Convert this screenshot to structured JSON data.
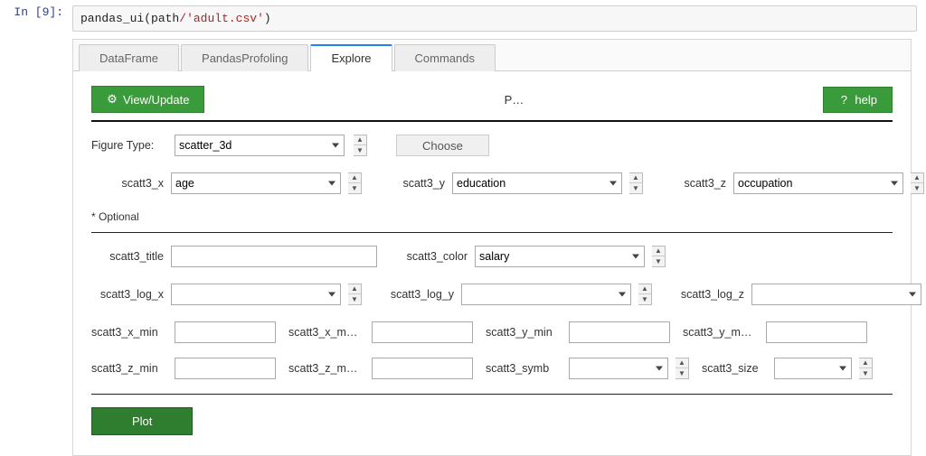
{
  "prompt": "In [9]:",
  "code": {
    "fn": "pandas_ui",
    "path_var": "path",
    "op": "/",
    "arg": "'adult.csv'"
  },
  "tabs": {
    "dataframe": "DataFrame",
    "profiling": "PandasProfoling",
    "explore": "Explore",
    "commands": "Commands",
    "active": "explore"
  },
  "panel": {
    "viewupdate": "View/Update",
    "viewupdate_icon": "⚙",
    "midchar": "P…",
    "help": "help",
    "help_icon": "?",
    "figure_type_label": "Figure Type:",
    "figure_type_value": "scatter_3d",
    "choose_label": "Choose",
    "optional": "* Optional",
    "plot_label": "Plot"
  },
  "row_main": {
    "x_label": "scatt3_x",
    "x_value": "age",
    "y_label": "scatt3_y",
    "y_value": "education",
    "z_label": "scatt3_z",
    "z_value": "occupation"
  },
  "row_opt1": {
    "title_label": "scatt3_title",
    "title_value": "",
    "color_label": "scatt3_color",
    "color_value": "salary"
  },
  "row_opt2": {
    "logx_label": "scatt3_log_x",
    "logx_value": "",
    "logy_label": "scatt3_log_y",
    "logy_value": "",
    "logz_label": "scatt3_log_z",
    "logz_value": ""
  },
  "row_opt3": {
    "xmin_label": "scatt3_x_min",
    "xmin_value": "",
    "xmax_label": "scatt3_x_m…",
    "xmax_value": "",
    "ymin_label": "scatt3_y_min",
    "ymin_value": "",
    "ymax_label": "scatt3_y_m…",
    "ymax_value": ""
  },
  "row_opt4": {
    "zmin_label": "scatt3_z_min",
    "zmin_value": "",
    "zmax_label": "scatt3_z_m…",
    "zmax_value": "",
    "symb_label": "scatt3_symb",
    "symb_value": "",
    "size_label": "scatt3_size",
    "size_value": ""
  }
}
